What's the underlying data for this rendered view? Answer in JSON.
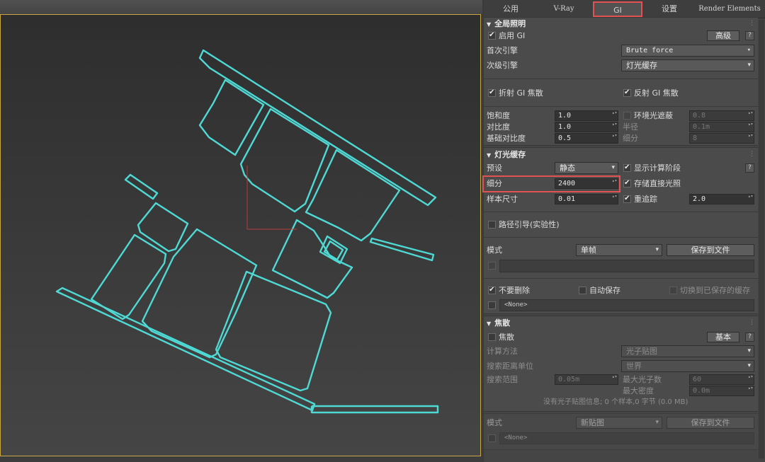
{
  "tabs": [
    "公用",
    "V-Ray",
    "GI",
    "设置",
    "Render Elements"
  ],
  "active_tab": "GI",
  "gi": {
    "header": "全局照明",
    "enable_label": "启用 GI",
    "enable_checked": true,
    "advanced_button": "高级",
    "help": "?",
    "primary_label": "首次引擎",
    "primary_value": "Brute force",
    "secondary_label": "次级引擎",
    "secondary_value": "灯光缓存",
    "refr_caustics_label": "折射 GI 焦散",
    "refl_caustics_label": "反射 GI 焦散",
    "saturation_label": "饱和度",
    "saturation_value": "1.0",
    "contrast_label": "对比度",
    "contrast_value": "1.0",
    "contrast_base_label": "基础对比度",
    "contrast_base_value": "0.5",
    "ao_label": "环境光遮蔽",
    "ao_value": "0.8",
    "radius_label": "半径",
    "radius_value": "0.1m",
    "subdivs_label": "细分",
    "subdivs_value": "8"
  },
  "lightcache": {
    "header": "灯光缓存",
    "preset_label": "预设",
    "preset_value": "静态",
    "show_calc_label": "显示计算阶段",
    "subdivs_label": "细分",
    "subdivs_value": "2400",
    "store_direct_label": "存储直接光照",
    "sample_size_label": "样本尺寸",
    "sample_size_value": "0.01",
    "retrace_label": "重追踪",
    "retrace_value": "2.0",
    "path_guiding_label": "路径引导(实验性)",
    "mode_label": "模式",
    "mode_value": "单帧",
    "save_button": "保存到文件",
    "dont_delete_label": "不要删除",
    "auto_save_label": "自动保存",
    "switch_saved_label": "切换到已保存的缓存",
    "file_value": "<None>"
  },
  "caustics": {
    "header": "焦散",
    "enable_label": "焦散",
    "basic_button": "基本",
    "help": "?",
    "calc_label": "计算方法",
    "calc_value": "光子贴图",
    "units_label": "搜索距离单位",
    "units_value": "世界",
    "search_label": "搜索范围",
    "search_value": "0.05m",
    "max_photons_label": "最大光子数",
    "max_photons_value": "60",
    "max_density_label": "最大密度",
    "max_density_value": "0.0m",
    "info": "没有光子贴图信息; 0 个样本,0 字节 (0.0 MB)",
    "mode_label": "模式",
    "mode_value": "新贴图",
    "save_button": "保存到文件",
    "file_value": "<None>"
  },
  "colors": {
    "wire": "#4fd9d4",
    "highlight": "#e25252",
    "viewport_border": "#c9a646"
  }
}
